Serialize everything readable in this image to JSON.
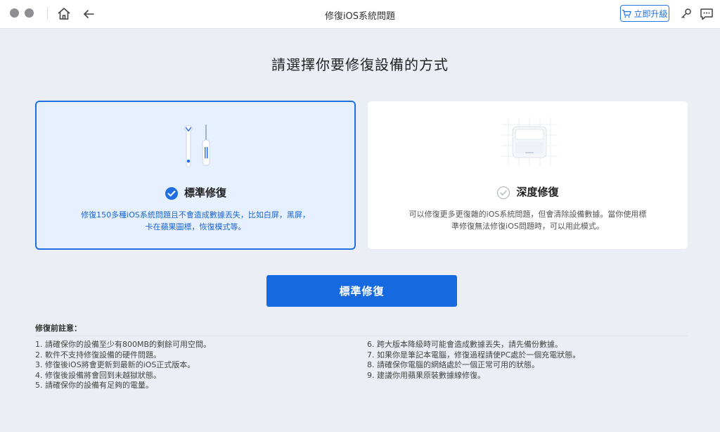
{
  "window": {
    "title": "修復iOS系統問題",
    "upgrade_label": "立即升級"
  },
  "main": {
    "heading": "請選擇你要修復設備的方式",
    "cards": [
      {
        "title": "標準修復",
        "description": "修復150多種iOS系統問題且不會造成數據丟失，比如白屏，黑屏，卡在蘋果圖標，恢復模式等。",
        "selected": true
      },
      {
        "title": "深度修復",
        "description": "可以修復更多更復雜的iOS系統問題，但會清除設備數據。當你使用標準修復無法修復iOS問題時，可以用此模式。",
        "selected": false
      }
    ],
    "primary_button": "標準修復"
  },
  "notes": {
    "title": "修復前註意：",
    "left": [
      "1. 請確保你的設備至少有800MB的剩餘可用空間。",
      "2. 軟件不支持修復設備的硬件問題。",
      "3. 修復後iOS將會更新到最新的iOS正式版本。",
      "4. 修復後設備將會回到未越獄狀態。",
      "5. 請確保你的設備有足夠的電量。"
    ],
    "right": [
      "6. 跨大版本降級時可能會造成數據丟失，請先備份數據。",
      "7. 如果你是筆記本電腦，修復過程請使PC處於一個充電狀態。",
      "8. 請確保你電腦的網絡處於一個正常可用的狀態。",
      "9. 建議你用蘋果原裝數據線修復。"
    ]
  },
  "colors": {
    "accent": "#1769e0",
    "selected_card_bg": "#e7f0fe",
    "background": "#ebeff5"
  }
}
